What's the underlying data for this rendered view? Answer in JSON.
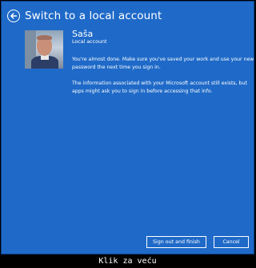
{
  "header": {
    "back_icon": "back-arrow-icon",
    "title": "Switch to a local account"
  },
  "user": {
    "avatar": "user-avatar",
    "name": "Saša",
    "account_type": "Local account"
  },
  "messages": {
    "almost_done": "You're almost done. Make sure you've saved your work and use your new password the next time you sign in.",
    "info": "The information associated with your Microsoft account still exists, but apps might ask you to sign in before accessing that info."
  },
  "buttons": {
    "sign_out": "Sign out and finish",
    "cancel": "Cancel"
  },
  "caption": "Klik za veću",
  "colors": {
    "background": "#1f6ac8",
    "text": "#ffffff",
    "frame": "#000000"
  }
}
